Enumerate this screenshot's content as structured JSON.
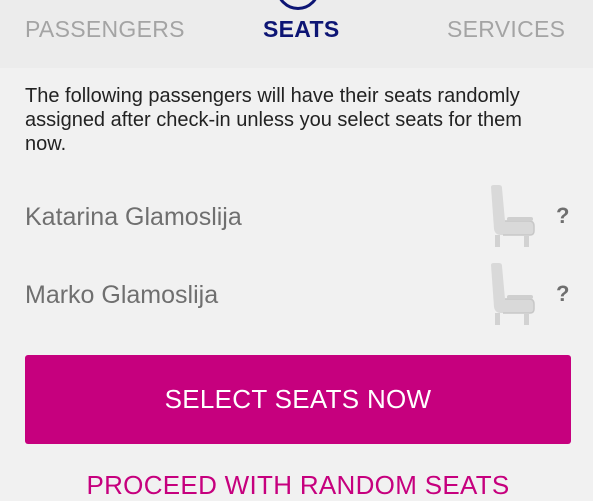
{
  "tabs": [
    {
      "label": "PASSENGERS",
      "active": false
    },
    {
      "label": "SEATS",
      "active": true
    },
    {
      "label": "SERVICES",
      "active": false
    }
  ],
  "intro_text": "The following passengers will have their seats randomly assigned after check-in unless you select seats for them now.",
  "passengers": [
    {
      "name": "Katarina Glamoslija",
      "seat": "?"
    },
    {
      "name": "Marko Glamoslija",
      "seat": "?"
    }
  ],
  "actions": {
    "primary_label": "SELECT SEATS NOW",
    "secondary_label": "PROCEED WITH RANDOM SEATS"
  },
  "colors": {
    "brand_magenta": "#c6007e",
    "active_tab": "#0d1574",
    "inactive_tab": "#a4a4a4"
  },
  "icons": {
    "seat": "seat-icon",
    "step_indicator": "step-circle-icon"
  }
}
